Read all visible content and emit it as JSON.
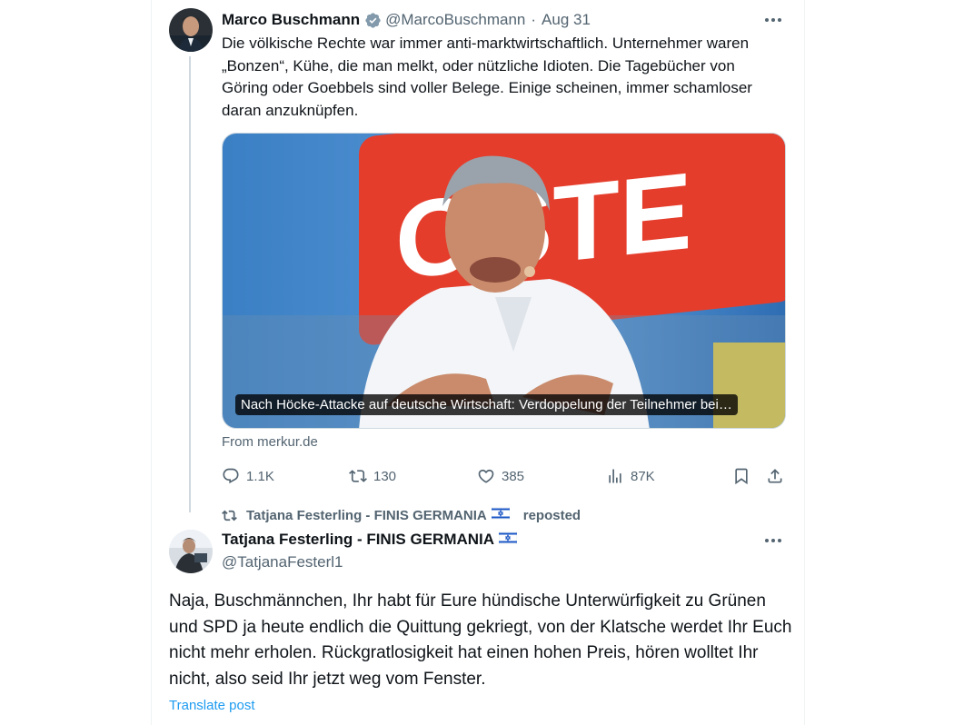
{
  "tweet": {
    "author_name": "Marco Buschmann",
    "handle": "@MarcoBuschmann",
    "separator": "·",
    "date": "Aug 31",
    "text": "Die völkische Rechte war immer anti-marktwirtschaftlich. Unternehmer waren „Bonzen“, Kühe, die man melkt, oder nützliche Idioten. Die Tagebücher von Göring oder Goebbels sind voller Belege. Einige scheinen, immer schamloser daran anzuknüpfen.",
    "card_caption": "Nach Höcke-Attacke auf deutsche Wirtschaft: Verdoppelung der Teilnehmer bei…",
    "card_source": "From merkur.de",
    "stats": {
      "replies": "1.1K",
      "reposts": "130",
      "likes": "385",
      "views": "87K"
    },
    "icons": [
      "verified-badge-icon",
      "more-icon",
      "reply-icon",
      "repost-icon",
      "like-icon",
      "views-icon",
      "bookmark-icon",
      "share-icon"
    ]
  },
  "repost_banner": {
    "text": "Tatjana Festerling - FINIS GERMANIA",
    "suffix": "reposted"
  },
  "reply": {
    "author_name": "Tatjana Festerling - FINIS GERMANIA",
    "handle": "@TatjanaFesterl1",
    "text": "Naja, Buschmännchen, Ihr habt für Eure hündische Unterwürfigkeit zu Grünen und SPD ja heute endlich die Quittung gekriegt, von der Klatsche werdet Ihr Euch nicht mehr erholen. Rückgratlosigkeit hat einen hohen Preis, hören wolltet Ihr nicht, also seid Ihr jetzt weg vom Fenster.",
    "translate_label": "Translate post"
  },
  "colors": {
    "text": "#0f1419",
    "muted": "#536471",
    "link": "#1d9bf0",
    "verified": "#829aab",
    "border": "#cfd9de"
  }
}
